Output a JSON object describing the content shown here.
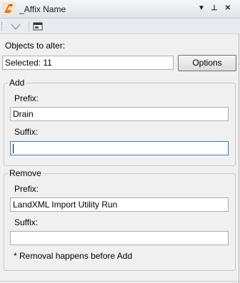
{
  "window": {
    "title": "_Affix Name",
    "dropdown_glyph": "▼",
    "pin_glyph": "⊥",
    "close_glyph": "✕"
  },
  "toolbar": {
    "icons": [
      "chevron-down-icon",
      "window-icon"
    ]
  },
  "objects": {
    "label": "Objects to alter:",
    "selected_value": "Selected: 11",
    "options_label": "Options"
  },
  "add": {
    "legend": "Add",
    "prefix_label": "Prefix:",
    "prefix_value": "Drain",
    "suffix_label": "Suffix:",
    "suffix_value": ""
  },
  "remove": {
    "legend": "Remove",
    "prefix_label": "Prefix:",
    "prefix_value": "LandXML Import Utility Run",
    "suffix_label": "Suffix:",
    "suffix_value": "",
    "note": "* Removal happens before Add"
  },
  "colors": {
    "focus_border": "#3d7bad",
    "icon_orange": "#e8731c"
  }
}
